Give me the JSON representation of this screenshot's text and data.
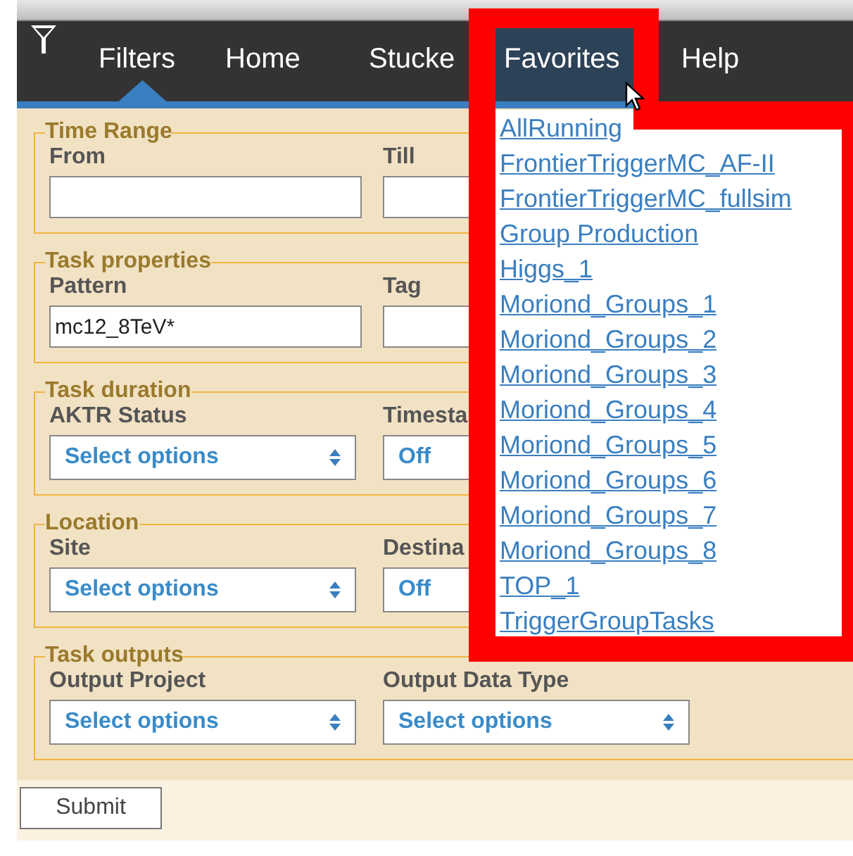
{
  "nav": {
    "items": [
      {
        "label": "Filters",
        "selected": true,
        "open": false
      },
      {
        "label": "Home",
        "selected": false,
        "open": false
      },
      {
        "label": "Stucke",
        "selected": false,
        "open": false
      },
      {
        "label": "Favorites",
        "selected": false,
        "open": true
      },
      {
        "label": "Help",
        "selected": false,
        "open": false
      }
    ]
  },
  "sections": [
    {
      "legend": "Time Range",
      "fields": [
        {
          "label": "From",
          "kind": "text"
        },
        {
          "label": "Till",
          "kind": "text"
        }
      ]
    },
    {
      "legend": "Task properties",
      "fields": [
        {
          "label": "Pattern",
          "kind": "text",
          "value": "mc12_8TeV*"
        },
        {
          "label": "Tag",
          "kind": "text"
        }
      ]
    },
    {
      "legend": "Task duration",
      "fields": [
        {
          "label": "AKTR Status",
          "kind": "select",
          "value": "Select options"
        },
        {
          "label": "Timesta",
          "kind": "switch-select",
          "value": "Off"
        }
      ]
    },
    {
      "legend": "Location",
      "fields": [
        {
          "label": "Site",
          "kind": "select",
          "value": "Select options"
        },
        {
          "label": "Destina",
          "kind": "switch-select",
          "value": "Off"
        }
      ]
    },
    {
      "legend": "Task outputs",
      "fields": [
        {
          "label": "Output Project",
          "kind": "select",
          "value": "Select options"
        },
        {
          "label": "Output Data Type",
          "kind": "select",
          "value": "Select options"
        }
      ]
    }
  ],
  "favorites_menu": {
    "items": [
      "AllRunning",
      "FrontierTriggerMC_AF-II",
      "FrontierTriggerMC_fullsim",
      "Group Production",
      "Higgs_1",
      "Moriond_Groups_1",
      "Moriond_Groups_2",
      "Moriond_Groups_3",
      "Moriond_Groups_4",
      "Moriond_Groups_5",
      "Moriond_Groups_6",
      "Moriond_Groups_7",
      "Moriond_Groups_8",
      "TOP_1",
      "TriggerGroupTasks"
    ]
  },
  "submit": "Submit"
}
